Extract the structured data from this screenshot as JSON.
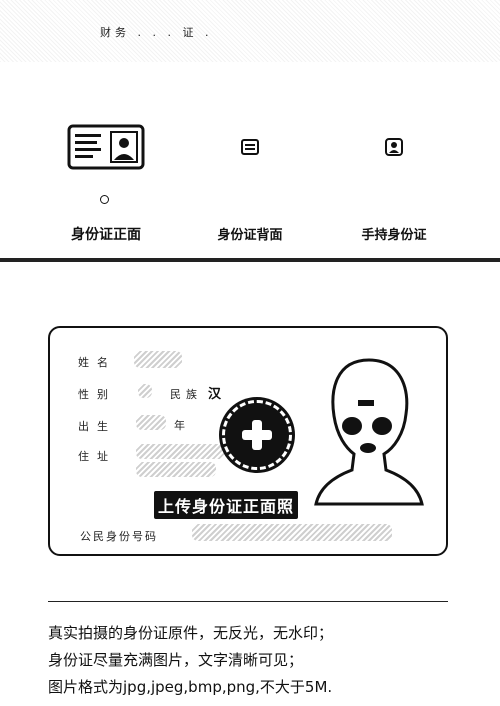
{
  "header": {
    "title": "财务 . . . 证 ."
  },
  "steps": [
    {
      "label": "身份证正面",
      "icon": "id-card-icon",
      "active": true
    },
    {
      "label": "身份证背面",
      "icon": "card-back-icon",
      "active": false
    },
    {
      "label": "手持身份证",
      "icon": "person-icon",
      "active": false
    }
  ],
  "card": {
    "name_label": "姓名",
    "gender_label": "性别",
    "nation_label": "民族",
    "nation_value": "汉",
    "birth_label": "出生",
    "year_label": "年",
    "address_label": "住址",
    "id_label": "公民身份号码",
    "upload_label": "上传身份证正面照"
  },
  "notes": [
    "真实拍摄的身份证原件，无反光，无水印；",
    "身份证尽量充满图片，文字清晰可见；",
    "图片格式为jpg,jpeg,bmp,png,不大于5M."
  ]
}
